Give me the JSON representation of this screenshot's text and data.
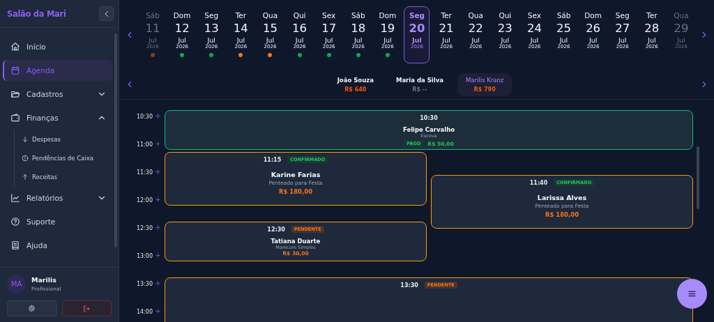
{
  "sidebar": {
    "brand": "Salão da Mari",
    "items": [
      {
        "label": "Início",
        "selected": false
      },
      {
        "label": "Agenda",
        "selected": true
      },
      {
        "label": "Cadastros",
        "selected": false,
        "expanded": false
      },
      {
        "label": "Finanças",
        "selected": false,
        "expanded": true,
        "children": [
          {
            "label": "Despesas",
            "selected": false
          },
          {
            "label": "Pendências de Caixa",
            "selected": false
          },
          {
            "label": "Receitas",
            "selected": false
          }
        ]
      },
      {
        "label": "Relatórios",
        "selected": false,
        "expanded": false
      },
      {
        "label": "Suporte",
        "selected": false
      },
      {
        "label": "Ajuda",
        "selected": false
      }
    ],
    "user": {
      "initials": "MA",
      "name": "Marilis",
      "role": "Profissional"
    }
  },
  "days": [
    {
      "weekday": "Sáb",
      "day": "11",
      "month": "Jul",
      "year": "2026",
      "selected": false,
      "muted": true,
      "color": "#7c3f1e"
    },
    {
      "weekday": "Dom",
      "day": "12",
      "month": "Jul",
      "year": "2026",
      "selected": false,
      "muted": false,
      "color": "#16a34a"
    },
    {
      "weekday": "Seg",
      "day": "13",
      "month": "Jul",
      "year": "2026",
      "selected": false,
      "muted": false,
      "color": "#16a34a"
    },
    {
      "weekday": "Ter",
      "day": "14",
      "month": "Jul",
      "year": "2026",
      "selected": false,
      "muted": false,
      "color": "#f97316"
    },
    {
      "weekday": "Qua",
      "day": "15",
      "month": "Jul",
      "year": "2026",
      "selected": false,
      "muted": false,
      "color": "#f97316"
    },
    {
      "weekday": "Qui",
      "day": "16",
      "month": "Jul",
      "year": "2026",
      "selected": false,
      "muted": false,
      "color": "#16a34a"
    },
    {
      "weekday": "Sex",
      "day": "17",
      "month": "Jul",
      "year": "2026",
      "selected": false,
      "muted": false,
      "color": "#16a34a"
    },
    {
      "weekday": "Sáb",
      "day": "18",
      "month": "Jul",
      "year": "2026",
      "selected": false,
      "muted": false,
      "color": "#16a34a"
    },
    {
      "weekday": "Dom",
      "day": "19",
      "month": "Jul",
      "year": "2026",
      "selected": false,
      "muted": false,
      "color": "#16a34a"
    },
    {
      "weekday": "Seg",
      "day": "20",
      "month": "Jul",
      "year": "2026",
      "selected": true,
      "muted": false
    },
    {
      "weekday": "Ter",
      "day": "21",
      "month": "Jul",
      "year": "2026",
      "selected": false,
      "muted": false
    },
    {
      "weekday": "Qua",
      "day": "22",
      "month": "Jul",
      "year": "2026",
      "selected": false,
      "muted": false
    },
    {
      "weekday": "Qui",
      "day": "23",
      "month": "Jul",
      "year": "2026",
      "selected": false,
      "muted": false
    },
    {
      "weekday": "Sex",
      "day": "24",
      "month": "Jul",
      "year": "2026",
      "selected": false,
      "muted": false
    },
    {
      "weekday": "Sáb",
      "day": "25",
      "month": "Jul",
      "year": "2026",
      "selected": false,
      "muted": false
    },
    {
      "weekday": "Dom",
      "day": "26",
      "month": "Jul",
      "year": "2026",
      "selected": false,
      "muted": false
    },
    {
      "weekday": "Seg",
      "day": "27",
      "month": "Jul",
      "year": "2026",
      "selected": false,
      "muted": false
    },
    {
      "weekday": "Ter",
      "day": "28",
      "month": "Jul",
      "year": "2026",
      "selected": false,
      "muted": false
    },
    {
      "weekday": "Qua",
      "day": "29",
      "month": "Jul",
      "year": "2026",
      "selected": false,
      "muted": true
    }
  ],
  "professionals": [
    {
      "name": "João Souza",
      "total": "R$ 640",
      "color": "#ea580c",
      "selected": false
    },
    {
      "name": "Maria da Silva",
      "total": "R$ --",
      "color": "#6b7280",
      "selected": false
    },
    {
      "name": "Marilis Kranz",
      "total": "R$ 790",
      "color": "#ea580c",
      "selected": true
    }
  ],
  "time_slots": [
    "10:30",
    "11:00",
    "11:30",
    "12:00",
    "12:30",
    "13:00",
    "13:30",
    "14:00"
  ],
  "appointments": [
    {
      "time": "10:30",
      "client": "Felipe Carvalho",
      "service": "Escova",
      "paid": true,
      "payment": "PAGO",
      "price": "R$ 50,00"
    },
    {
      "time": "11:15",
      "status": {
        "label": "CONFIRMADO",
        "kind": "confirmed"
      },
      "client": "Karine Farias",
      "service": "Penteado para Festa",
      "paid": false,
      "price": "R$ 180,00"
    },
    {
      "time": "11:40",
      "status": {
        "label": "CONFIRMADO",
        "kind": "confirmed"
      },
      "client": "Larissa Alves",
      "service": "Penteado para Festa",
      "paid": false,
      "price": "R$ 180,00"
    },
    {
      "time": "12:30",
      "status": {
        "label": "PENDENTE",
        "kind": "pending"
      },
      "client": "Tatiana Duarte",
      "service": "Manicure Simples",
      "paid": false,
      "price": "R$ 30,00"
    },
    {
      "time": "13:30",
      "status": {
        "label": "PENDENTE",
        "kind": "pending"
      },
      "paid": false
    }
  ]
}
